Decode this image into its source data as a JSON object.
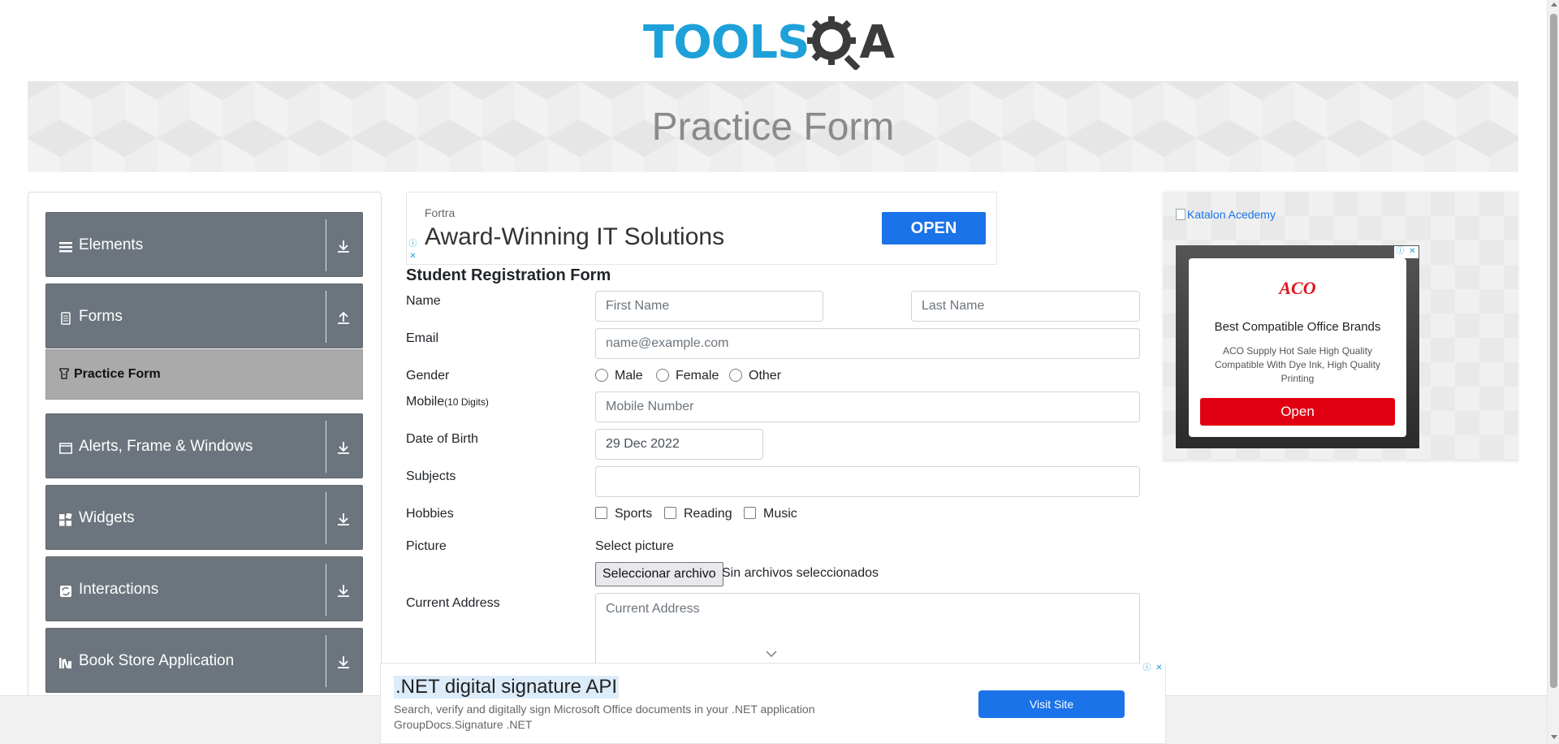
{
  "header": {
    "logo": {
      "part1": "TOOLS",
      "part2": "A"
    },
    "page_title": "Practice Form"
  },
  "sidebar": {
    "groups": [
      {
        "label": "Elements",
        "icon": "hamburger-icon",
        "arrow": "download-arrow-icon"
      },
      {
        "label": "Forms",
        "icon": "document-icon",
        "arrow": "upload-arrow-icon"
      },
      {
        "label": "Alerts, Frame & Windows",
        "icon": "window-icon",
        "arrow": "download-arrow-icon"
      },
      {
        "label": "Widgets",
        "icon": "widgets-grid-icon",
        "arrow": "download-arrow-icon"
      },
      {
        "label": "Interactions",
        "icon": "interactions-icon",
        "arrow": "download-arrow-icon"
      },
      {
        "label": "Book Store Application",
        "icon": "books-icon",
        "arrow": "download-arrow-icon"
      }
    ],
    "active_item": {
      "label": "Practice Form",
      "icon": "form-icon"
    }
  },
  "top_ad": {
    "brand": "Fortra",
    "headline": "Award-Winning IT Solutions",
    "button": "OPEN",
    "adchoice_info": "ⓘ",
    "adchoice_close": "✕"
  },
  "form": {
    "title": "Student Registration Form",
    "labels": {
      "name": "Name",
      "email": "Email",
      "gender": "Gender",
      "mobile": "Mobile",
      "mobile_hint": "(10 Digits)",
      "dob": "Date of Birth",
      "subjects": "Subjects",
      "hobbies": "Hobbies",
      "picture": "Picture",
      "address": "Current Address"
    },
    "placeholders": {
      "first_name": "First Name",
      "last_name": "Last Name",
      "email": "name@example.com",
      "mobile": "Mobile Number",
      "address": "Current Address"
    },
    "values": {
      "first_name": "",
      "last_name": "",
      "email": "",
      "mobile": "",
      "dob": "29 Dec 2022",
      "subjects": "",
      "address": ""
    },
    "gender_options": [
      "Male",
      "Female",
      "Other"
    ],
    "hobby_options": [
      "Sports",
      "Reading",
      "Music"
    ],
    "picture": {
      "select_label": "Select picture",
      "button": "Seleccionar archivo",
      "status": "Sin archivos seleccionados"
    }
  },
  "right_ad": {
    "link": "Katalon Acedemy",
    "logo": "ACO",
    "title": "Best Compatible Office Brands",
    "text": "ACO Supply Hot Sale High Quality Compatible With Dye Ink, High Quality Printing",
    "button": "Open",
    "adchoice_info": "ⓘ",
    "adchoice_close": "✕"
  },
  "bottom_ad": {
    "title": ".NET digital signature API",
    "description": "Search, verify and digitally sign Microsoft Office documents in your .NET application",
    "source": "GroupDocs.Signature .NET",
    "button": "Visit Site",
    "adchoice_info": "ⓘ",
    "adchoice_close": "✕"
  },
  "colors": {
    "sidebar_group_bg": "#6c757d",
    "active_item_bg": "#aaaaaa",
    "logo_blue": "#1da1d8",
    "ad_button_blue": "#1a73e8",
    "aco_red": "#e10012"
  }
}
